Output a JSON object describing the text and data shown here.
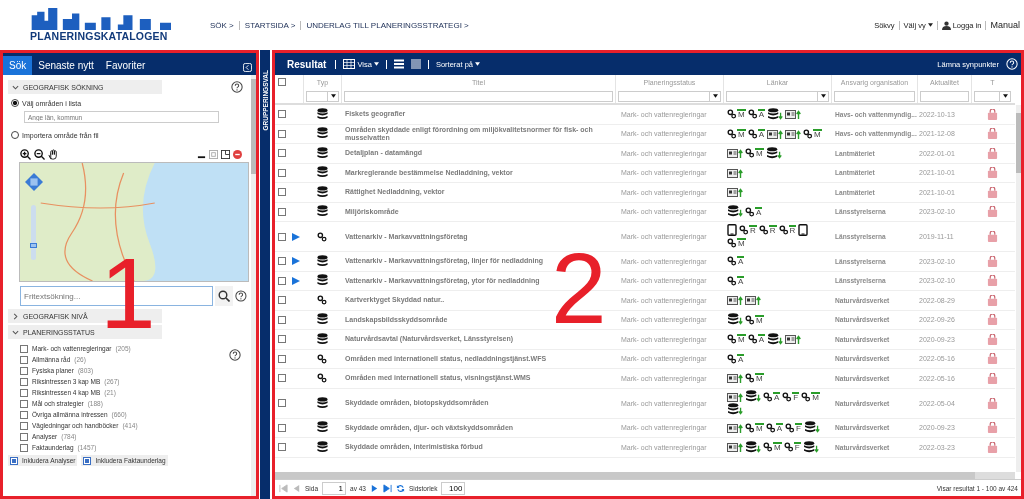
{
  "header": {
    "logo_text": "PLANERINGSKATALOGEN",
    "breadcrumbs": [
      "SÖK >",
      "STARTSIDA >",
      "UNDERLAG TILL PLANERINGSSTRATEGI >"
    ],
    "menu": [
      {
        "kind": "plain",
        "label": "Sökvy"
      },
      {
        "kind": "dropdown",
        "label": "Välj vy"
      },
      {
        "kind": "user",
        "label": "Logga in"
      },
      {
        "kind": "plain",
        "label": "Manual"
      }
    ]
  },
  "sidebar": {
    "tabs": [
      {
        "label": "Sök",
        "selected": true
      },
      {
        "label": "Senaste nytt",
        "selected": false
      },
      {
        "label": "Favoriter",
        "selected": false
      }
    ],
    "geo_search": {
      "title": "GEOGRAFISK SÖKNING",
      "expanded": true,
      "options": [
        {
          "label": "Välj områden i lista",
          "selected": true
        },
        {
          "label": "Importera område från fil",
          "selected": false
        }
      ],
      "area_field": {
        "placeholder": "Ange län, kommun"
      },
      "map_zoom": {
        "level": 0.25
      }
    },
    "search_field": {
      "placeholder": "Fritextsökning..."
    },
    "geo_level": {
      "title": "GEOGRAFISK NIVÅ",
      "expanded": false
    },
    "planning_status": {
      "title": "PLANERINGSSTATUS",
      "expanded": true,
      "items": [
        {
          "label": "Mark- och vattenregleringar",
          "count": "(205)",
          "checked": false
        },
        {
          "label": "Allmänna råd",
          "count": "(26)",
          "checked": false
        },
        {
          "label": "Fysiska planer",
          "count": "(803)",
          "checked": false
        },
        {
          "label": "Riksintressen 3 kap MB",
          "count": "(267)",
          "checked": false
        },
        {
          "label": "Riksintressen 4 kap MB",
          "count": "(21)",
          "checked": false
        },
        {
          "label": "Mål och strategier",
          "count": "(188)",
          "checked": false
        },
        {
          "label": "Övriga allmänna intressen",
          "count": "(660)",
          "checked": false
        },
        {
          "label": "Vägledningar och handböcker",
          "count": "(414)",
          "checked": false
        },
        {
          "label": "Analyser",
          "count": "(784)",
          "checked": false
        },
        {
          "label": "Faktaunderlag",
          "count": "(1457)",
          "checked": false
        }
      ]
    },
    "includes": [
      {
        "label": "Inkludera Analyser",
        "checked": true
      },
      {
        "label": "Inkludera Faktaunderlag",
        "checked": true
      }
    ]
  },
  "grouping_bar": {
    "label": "GRUPPERINGSVAL"
  },
  "results": {
    "title": "Resultat",
    "view_menu": "Visa",
    "sort_menu": "Sorterat på",
    "feedback_link": "Lämna synpunkter",
    "select_all": {
      "checked": false
    },
    "columns": [
      {
        "label": "Typ",
        "kind": "dropdown"
      },
      {
        "label": "Titel",
        "kind": "text"
      },
      {
        "label": "Planeringsstatus",
        "kind": "dropdown"
      },
      {
        "label": "Länkar",
        "kind": "dropdown"
      },
      {
        "label": "Ansvarig organisation",
        "kind": "text"
      },
      {
        "label": "Aktualitet",
        "kind": "text"
      },
      {
        "label": "T",
        "kind": "dropdown"
      }
    ],
    "rows": [
      {
        "checked": false,
        "expandable": false,
        "kind": "dataset",
        "title": "Fiskets geografier",
        "status": "Mark- och vattenregleringar",
        "links": [
          {
            "kind": "service",
            "letter": "M"
          },
          {
            "kind": "service",
            "letter": "A"
          },
          {
            "kind": "database"
          },
          {
            "kind": "document"
          }
        ],
        "organisation": "Havs- och vattenmyndig...",
        "date": "2022-10-13"
      },
      {
        "checked": false,
        "expandable": false,
        "kind": "dataset",
        "title": "Områden skyddade enligt förordning om miljökvalitetsnormer för fisk- och musselvatten",
        "status": "Mark- och vattenregleringar",
        "links": [
          {
            "kind": "service",
            "letter": "M"
          },
          {
            "kind": "service",
            "letter": "A"
          },
          {
            "kind": "document"
          },
          {
            "kind": "document"
          },
          {
            "kind": "service",
            "letter": "M"
          }
        ],
        "organisation": "Havs- och vattenmyndig...",
        "date": "2021-12-08"
      },
      {
        "checked": false,
        "expandable": false,
        "kind": "dataset",
        "title": "Detaljplan - datamängd",
        "status": "Mark- och vattenregleringar",
        "links": [
          {
            "kind": "document"
          },
          {
            "kind": "service",
            "letter": "M"
          },
          {
            "kind": "database"
          }
        ],
        "organisation": "Lantmäteriet",
        "date": "2022-01-01"
      },
      {
        "checked": false,
        "expandable": false,
        "kind": "dataset",
        "title": "Markreglerande bestämmelse Nedladdning, vektor",
        "status": "Mark- och vattenregleringar",
        "links": [
          {
            "kind": "document"
          }
        ],
        "organisation": "Lantmäteriet",
        "date": "2021-10-01"
      },
      {
        "checked": false,
        "expandable": false,
        "kind": "dataset",
        "title": "Rättighet Nedladdning, vektor",
        "status": "Mark- och vattenregleringar",
        "links": [
          {
            "kind": "document"
          }
        ],
        "organisation": "Lantmäteriet",
        "date": "2021-10-01"
      },
      {
        "checked": false,
        "expandable": false,
        "kind": "dataset",
        "title": "Miljöriskområde",
        "status": "Mark- och vattenregleringar",
        "links": [
          {
            "kind": "database"
          },
          {
            "kind": "service",
            "letter": "A"
          }
        ],
        "organisation": "Länsstyrelserna",
        "date": "2023-02-10"
      },
      {
        "checked": false,
        "expandable": true,
        "kind": "service",
        "title": "Vattenarkiv - Markavvattningsföretag",
        "status": "Mark- och vattenregleringar",
        "links": [
          {
            "kind": "tablet"
          },
          {
            "kind": "service",
            "letter": "R"
          },
          {
            "kind": "service",
            "letter": "R"
          },
          {
            "kind": "service",
            "letter": "R"
          },
          {
            "kind": "tablet"
          },
          {
            "kind": "service",
            "letter": "M"
          }
        ],
        "organisation": "Länsstyrelserna",
        "date": "2019-11-11"
      },
      {
        "checked": false,
        "expandable": true,
        "kind": "dataset",
        "title": "Vattenarkiv - Markavvattningsföretag, linjer för nedladdning",
        "status": "Mark- och vattenregleringar",
        "links": [
          {
            "kind": "service",
            "letter": "A"
          }
        ],
        "organisation": "Länsstyrelserna",
        "date": "2023-02-10"
      },
      {
        "checked": false,
        "expandable": true,
        "kind": "dataset",
        "title": "Vattenarkiv - Markavvattningsföretag, ytor för nedladdning",
        "status": "Mark- och vattenregleringar",
        "links": [
          {
            "kind": "service",
            "letter": "A"
          }
        ],
        "organisation": "Länsstyrelserna",
        "date": "2023-02-10"
      },
      {
        "checked": false,
        "expandable": false,
        "kind": "service",
        "title": "Kartverktyget Skyddad natur..",
        "status": "Mark- och vattenregleringar",
        "links": [
          {
            "kind": "document"
          },
          {
            "kind": "document"
          }
        ],
        "organisation": "Naturvårdsverket",
        "date": "2022-08-29"
      },
      {
        "checked": false,
        "expandable": false,
        "kind": "dataset",
        "title": "Landskapsbildsskyddsområde",
        "status": "Mark- och vattenregleringar",
        "links": [
          {
            "kind": "database"
          },
          {
            "kind": "service",
            "letter": "M"
          }
        ],
        "organisation": "Naturvårdsverket",
        "date": "2022-09-26"
      },
      {
        "checked": false,
        "expandable": false,
        "kind": "dataset",
        "title": "Naturvårdsavtal (Naturvårdsverket, Länsstyrelsen)",
        "status": "Mark- och vattenregleringar",
        "links": [
          {
            "kind": "service",
            "letter": "M"
          },
          {
            "kind": "service",
            "letter": "A"
          },
          {
            "kind": "database"
          },
          {
            "kind": "document"
          }
        ],
        "organisation": "Naturvårdsverket",
        "date": "2020-09-23"
      },
      {
        "checked": false,
        "expandable": false,
        "kind": "service",
        "title": "Områden med internationell status, nedladdningstjänst.WFS",
        "status": "Mark- och vattenregleringar",
        "links": [
          {
            "kind": "service",
            "letter": "A"
          }
        ],
        "organisation": "Naturvårdsverket",
        "date": "2022-05-16"
      },
      {
        "checked": false,
        "expandable": false,
        "kind": "service",
        "title": "Områden med internationell status, visningstjänst.WMS",
        "status": "Mark- och vattenregleringar",
        "links": [
          {
            "kind": "document"
          },
          {
            "kind": "service",
            "letter": "M"
          }
        ],
        "organisation": "Naturvårdsverket",
        "date": "2022-05-16"
      },
      {
        "checked": false,
        "expandable": false,
        "kind": "dataset",
        "title": "Skyddade områden, biotopskyddsområden",
        "status": "Mark- och vattenregleringar",
        "links": [
          {
            "kind": "document"
          },
          {
            "kind": "database"
          },
          {
            "kind": "service",
            "letter": "A"
          },
          {
            "kind": "service",
            "letter": "F"
          },
          {
            "kind": "service",
            "letter": "M"
          },
          {
            "kind": "database"
          }
        ],
        "organisation": "Naturvårdsverket",
        "date": "2022-05-04"
      },
      {
        "checked": false,
        "expandable": false,
        "kind": "dataset",
        "title": "Skyddade områden, djur- och växtskyddsområden",
        "status": "Mark- och vattenregleringar",
        "links": [
          {
            "kind": "document"
          },
          {
            "kind": "service",
            "letter": "M"
          },
          {
            "kind": "service",
            "letter": "A"
          },
          {
            "kind": "service",
            "letter": "F"
          },
          {
            "kind": "database"
          }
        ],
        "organisation": "Naturvårdsverket",
        "date": "2020-09-23"
      },
      {
        "checked": false,
        "expandable": false,
        "kind": "dataset",
        "title": "Skyddade områden, interimistiska förbud",
        "status": "Mark- och vattenregleringar",
        "links": [
          {
            "kind": "document"
          },
          {
            "kind": "database"
          },
          {
            "kind": "service",
            "letter": "M"
          },
          {
            "kind": "service",
            "letter": "F"
          },
          {
            "kind": "database"
          }
        ],
        "organisation": "Naturvårdsverket",
        "date": "2022-03-23"
      }
    ],
    "pager": {
      "page_label": "Sida",
      "page": "1",
      "page_count": "av 43",
      "size_label": "Sidstorlek",
      "size": "100",
      "summary": "Visar resultat 1 - 100 av 424"
    }
  },
  "annotations": [
    {
      "label": "1"
    },
    {
      "label": "2"
    }
  ]
}
